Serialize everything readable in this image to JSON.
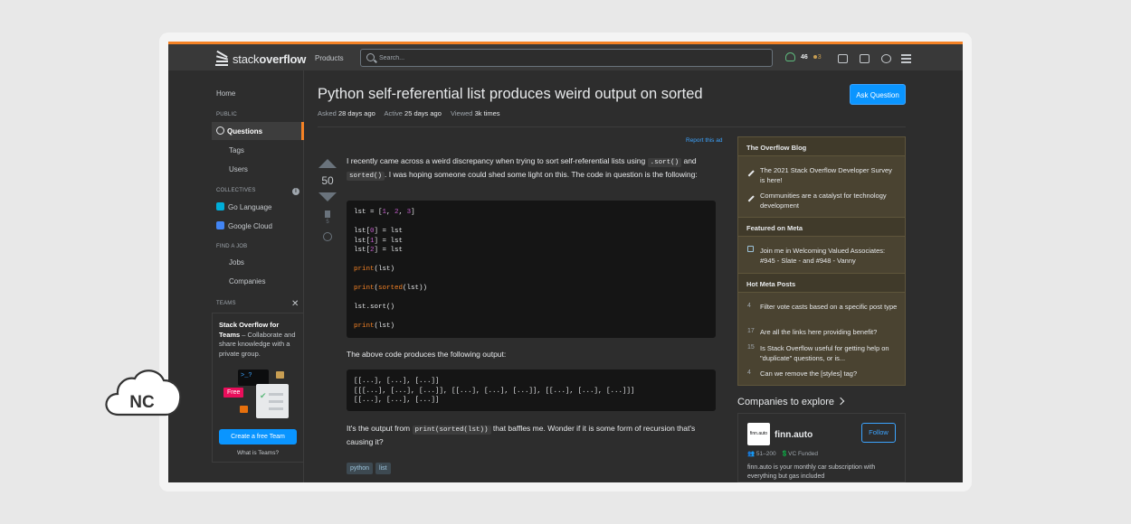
{
  "header": {
    "logo_light": "stack",
    "logo_bold": "overflow",
    "products": "Products",
    "search_placeholder": "Search...",
    "reputation": "46",
    "bronze_badges": "3"
  },
  "leftnav": {
    "home": "Home",
    "public": "PUBLIC",
    "questions": "Questions",
    "tags": "Tags",
    "users": "Users",
    "collectives": "COLLECTIVES",
    "go": "Go Language",
    "cloud": "Google Cloud",
    "find_job": "FIND A JOB",
    "jobs": "Jobs",
    "companies": "Companies",
    "teams": "TEAMS",
    "teams_title": "Stack Overflow for Teams",
    "teams_text": " – Collaborate and share knowledge with a private group.",
    "term_text": ">_?",
    "free": "Free",
    "create_team": "Create a free Team",
    "what_teams": "What is Teams?"
  },
  "question": {
    "title": "Python self-referential list produces weird output on sorted",
    "asked_label": "Asked",
    "asked": "28 days ago",
    "active_label": "Active",
    "active": "25 days ago",
    "viewed_label": "Viewed",
    "viewed": "3k times",
    "ask_button": "Ask Question",
    "report_ad": "Report this ad",
    "votes": "50",
    "bookmarks": "5",
    "p1_a": "I recently came across a weird discrepancy when trying to sort self-referential lists using ",
    "p1_code1": ".sort()",
    "p1_b": " and ",
    "p1_code2": "sorted()",
    "p1_c": ". I was hoping someone could shed some light on this. The code in question is the following:",
    "code1": {
      "l1a": "lst = [",
      "l1n1": "1",
      "l1s1": ", ",
      "l1n2": "2",
      "l1s2": ", ",
      "l1n3": "3",
      "l1e": "]",
      "l2a": "lst[",
      "l2n": "0",
      "l2e": "] = lst",
      "l3a": "lst[",
      "l3n": "1",
      "l3e": "] = lst",
      "l4a": "lst[",
      "l4n": "2",
      "l4e": "] = lst",
      "l5k": "print",
      "l5e": "(lst)",
      "l6k": "print",
      "l6o": "(",
      "l6k2": "sorted",
      "l6e": "(lst))",
      "l7": "lst.sort()",
      "l8k": "print",
      "l8e": "(lst)"
    },
    "p2": "The above code produces the following output:",
    "output": [
      "[[...], [...], [...]]",
      "[[[...], [...], [...]], [[...], [...], [...]], [[...], [...], [...]]]",
      "[[...], [...], [...]]"
    ],
    "p3_a": "It's the output from ",
    "p3_code": "print(sorted(lst))",
    "p3_b": " that baffles me. Wonder if it is some form of recursion that's causing it?",
    "tags": [
      "python",
      "list"
    ]
  },
  "sidebar": {
    "blog_title": "The Overflow Blog",
    "blog1": "The 2021 Stack Overflow Developer Survey is here!",
    "blog2": "Communities are a catalyst for technology development",
    "meta_title": "Featured on Meta",
    "meta1": "Join me in Welcoming Valued Associates: #945 - Slate - and #948 - Vanny",
    "hot_title": "Hot Meta Posts",
    "hot": [
      {
        "count": "4",
        "text": "Filter vote casts based on a specific post type"
      },
      {
        "count": "17",
        "text": "Are all the links here providing benefit?"
      },
      {
        "count": "15",
        "text": "Is Stack Overflow useful for getting help on \"duplicate\" questions, or is..."
      },
      {
        "count": "4",
        "text": "Can we remove the [styles] tag?"
      }
    ],
    "companies_title": "Companies to explore",
    "company_logo": "finn.auto",
    "company_name": "finn.auto",
    "follow": "Follow",
    "company_size": "51–200",
    "company_funding": "VC Funded",
    "company_desc": "finn.auto is your monthly car subscription with everything but gas included"
  },
  "watermark": {
    "text": "NC"
  }
}
